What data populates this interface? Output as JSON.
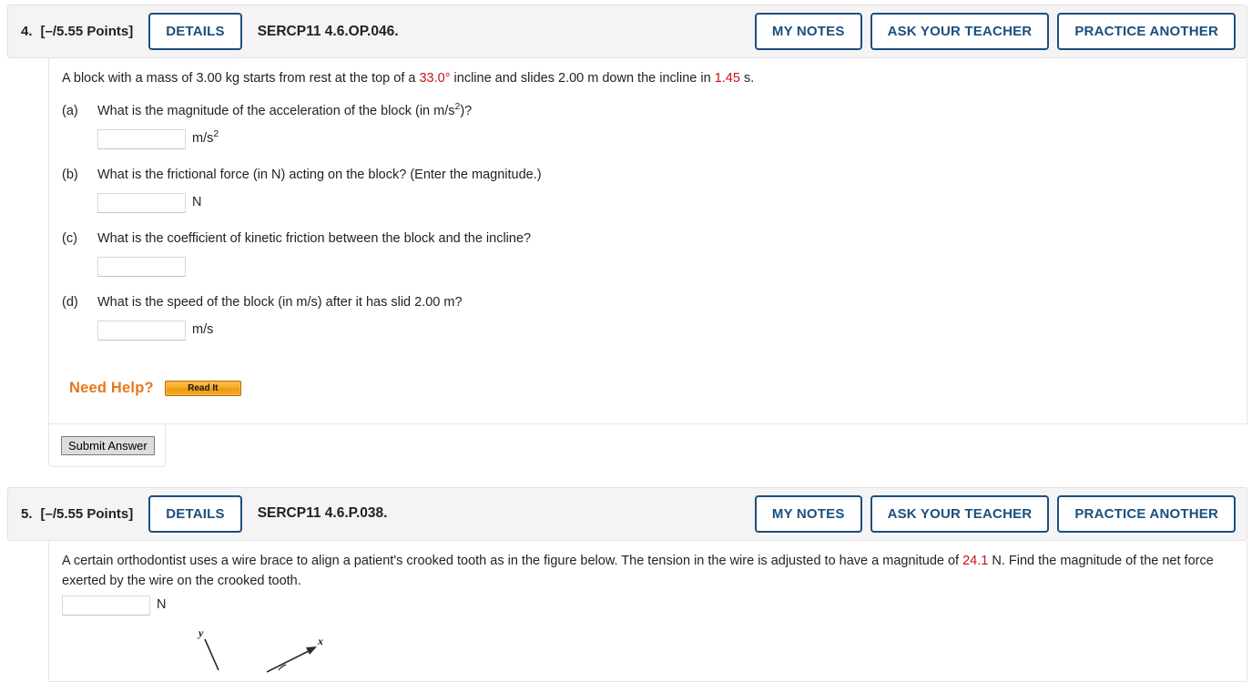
{
  "colors": {
    "accent_blue": "#1b4f7e",
    "highlight_red": "#cc1111",
    "need_help_orange": "#e8771a",
    "header_bg": "#f4f4f4"
  },
  "questions": [
    {
      "number": "4.",
      "points": "[–/5.55 Points]",
      "details_label": "DETAILS",
      "code": "SERCP11 4.6.OP.046.",
      "actions": [
        {
          "label": "MY NOTES",
          "name": "my-notes-button"
        },
        {
          "label": "ASK YOUR TEACHER",
          "name": "ask-your-teacher-button"
        },
        {
          "label": "PRACTICE ANOTHER",
          "name": "practice-another-button"
        }
      ],
      "prompt": {
        "seg1": "A block with a mass of 3.00 kg starts from rest at the top of a ",
        "angle": "33.0°",
        "seg2": " incline and slides 2.00 m down the incline in ",
        "time": "1.45",
        "seg3": " s."
      },
      "parts": [
        {
          "label": "(a)",
          "text_pre": "What is the magnitude of the acceleration of the block (in m/s",
          "text_sup": "2",
          "text_post": ")?",
          "value": "",
          "placeholder": "",
          "unit_pre": "m/s",
          "unit_sup": "2"
        },
        {
          "label": "(b)",
          "text_pre": "What is the frictional force (in N) acting on the block? (Enter the magnitude.)",
          "text_sup": "",
          "text_post": "",
          "value": "",
          "placeholder": "",
          "unit_pre": "N",
          "unit_sup": ""
        },
        {
          "label": "(c)",
          "text_pre": "What is the coefficient of kinetic friction between the block and the incline?",
          "text_sup": "",
          "text_post": "",
          "value": "",
          "placeholder": "",
          "unit_pre": "",
          "unit_sup": ""
        },
        {
          "label": "(d)",
          "text_pre": "What is the speed of the block (in m/s) after it has slid 2.00 m?",
          "text_sup": "",
          "text_post": "",
          "value": "",
          "placeholder": "",
          "unit_pre": "m/s",
          "unit_sup": ""
        }
      ],
      "need_help_label": "Need Help?",
      "read_it_label": "Read It",
      "submit_label": "Submit Answer"
    },
    {
      "number": "5.",
      "points": "[–/5.55 Points]",
      "details_label": "DETAILS",
      "code": "SERCP11 4.6.P.038.",
      "actions": [
        {
          "label": "MY NOTES",
          "name": "my-notes-button"
        },
        {
          "label": "ASK YOUR TEACHER",
          "name": "ask-your-teacher-button"
        },
        {
          "label": "PRACTICE ANOTHER",
          "name": "practice-another-button"
        }
      ],
      "prompt": {
        "seg1": "A certain orthodontist uses a wire brace to align a patient's crooked tooth as in the figure below. The tension in the wire is adjusted to have a magnitude of ",
        "tension": "24.1",
        "seg2": " N. Find the magnitude of the net force exerted by the wire on the crooked tooth."
      },
      "answer": {
        "value": "",
        "placeholder": "",
        "unit": "N"
      },
      "figure": {
        "y_axis_label": "y",
        "x_axis_label": "x"
      }
    }
  ]
}
